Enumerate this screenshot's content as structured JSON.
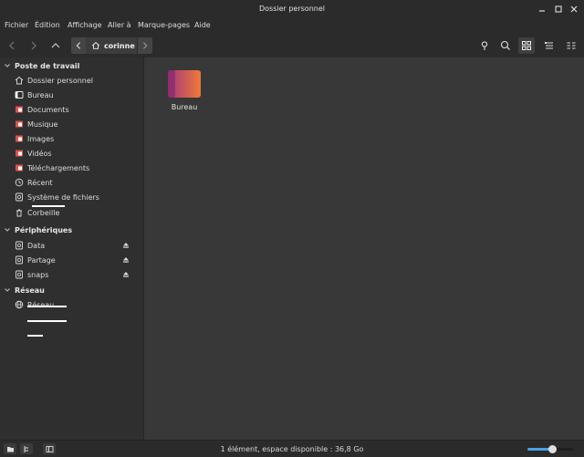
{
  "window": {
    "title": "Dossier personnel"
  },
  "menu": [
    "Fichier",
    "Édition",
    "Affichage",
    "Aller à",
    "Marque-pages",
    "Aide"
  ],
  "toolbar": {
    "current_folder": "corinne"
  },
  "sidebar": {
    "sections": [
      {
        "title": "Poste de travail",
        "items": [
          {
            "label": "Dossier personnel",
            "icon": "home-icon"
          },
          {
            "label": "Bureau",
            "icon": "desktop-icon"
          },
          {
            "label": "Documents",
            "icon": "documents-folder-icon"
          },
          {
            "label": "Musique",
            "icon": "music-folder-icon"
          },
          {
            "label": "Images",
            "icon": "pictures-folder-icon"
          },
          {
            "label": "Vidéos",
            "icon": "videos-folder-icon"
          },
          {
            "label": "Téléchargements",
            "icon": "downloads-folder-icon"
          },
          {
            "label": "Récent",
            "icon": "recent-icon"
          },
          {
            "label": "Système de fichiers",
            "icon": "filesystem-icon"
          },
          {
            "label": "Corbeille",
            "icon": "trash-icon"
          }
        ]
      },
      {
        "title": "Périphériques",
        "items": [
          {
            "label": "Data",
            "icon": "drive-icon"
          },
          {
            "label": "Partage",
            "icon": "drive-icon"
          },
          {
            "label": "snaps",
            "icon": "drive-icon"
          }
        ]
      },
      {
        "title": "Réseau",
        "items": [
          {
            "label": "Réseau",
            "icon": "network-icon"
          }
        ]
      }
    ]
  },
  "content": {
    "items": [
      {
        "label": "Bureau",
        "icon": "desktop-folder-icon"
      }
    ]
  },
  "status": {
    "text": "1 élément, espace disponible : 36,8 Go",
    "zoom_level": 0.55
  },
  "colors": {
    "accent": "#4aa1e8",
    "folder_start": "#a2367c",
    "folder_end": "#f07a3a"
  }
}
